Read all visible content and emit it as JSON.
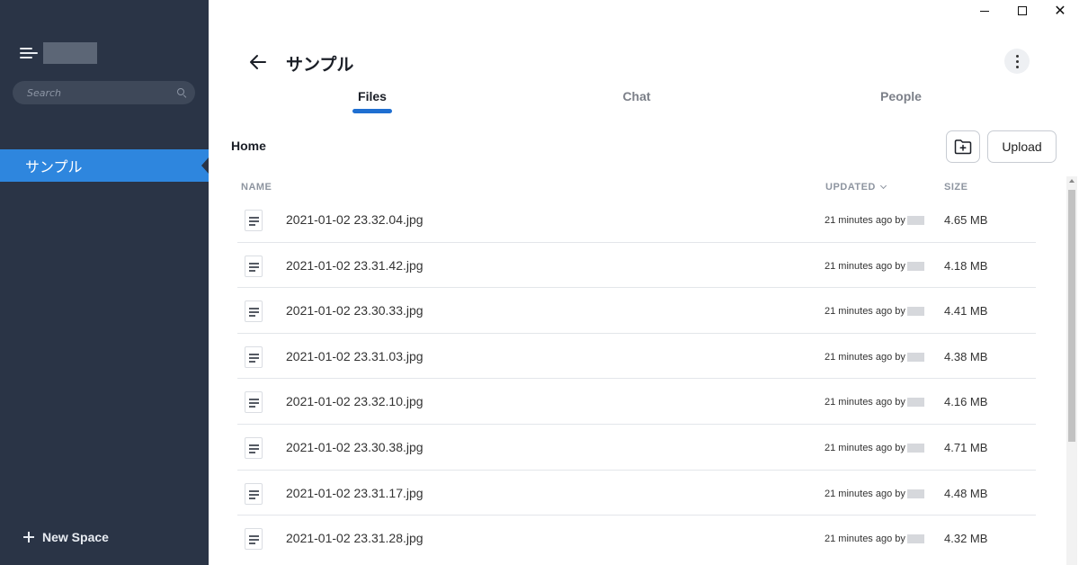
{
  "window": {
    "minimize": "—",
    "maximize": "☐",
    "close": "✕"
  },
  "sidebar": {
    "search_placeholder": "Search",
    "spaces": [
      {
        "label": "サンプル",
        "active": true
      }
    ],
    "new_space_label": "New Space"
  },
  "header": {
    "title": "サンプル"
  },
  "tabs": [
    {
      "label": "Files",
      "active": true
    },
    {
      "label": "Chat",
      "active": false
    },
    {
      "label": "People",
      "active": false
    }
  ],
  "toolbar": {
    "breadcrumb": "Home",
    "upload_label": "Upload"
  },
  "table": {
    "columns": {
      "name": "NAME",
      "updated": "UPDATED",
      "size": "SIZE"
    },
    "sort": {
      "column": "updated",
      "direction": "descending"
    },
    "rows": [
      {
        "name": "2021-01-02 23.32.04.jpg",
        "updated": "21 minutes ago by",
        "size": "4.65 MB"
      },
      {
        "name": "2021-01-02 23.31.42.jpg",
        "updated": "21 minutes ago by",
        "size": "4.18 MB"
      },
      {
        "name": "2021-01-02 23.30.33.jpg",
        "updated": "21 minutes ago by",
        "size": "4.41 MB"
      },
      {
        "name": "2021-01-02 23.31.03.jpg",
        "updated": "21 minutes ago by",
        "size": "4.38 MB"
      },
      {
        "name": "2021-01-02 23.32.10.jpg",
        "updated": "21 minutes ago by",
        "size": "4.16 MB"
      },
      {
        "name": "2021-01-02 23.30.38.jpg",
        "updated": "21 minutes ago by",
        "size": "4.71 MB"
      },
      {
        "name": "2021-01-02 23.31.17.jpg",
        "updated": "21 minutes ago by",
        "size": "4.48 MB"
      },
      {
        "name": "2021-01-02 23.31.28.jpg",
        "updated": "21 minutes ago by",
        "size": "4.32 MB"
      }
    ]
  },
  "colors": {
    "sidebar_bg": "#2a3446",
    "sidebar_active": "#2e86de",
    "tab_underline": "#1f6fd1"
  },
  "icons": [
    "menu-icon",
    "search-icon",
    "plus-icon",
    "back-arrow-icon",
    "more-vertical-icon",
    "new-folder-icon",
    "file-icon",
    "chevron-down-icon",
    "minimize-icon",
    "maximize-icon",
    "close-icon"
  ]
}
